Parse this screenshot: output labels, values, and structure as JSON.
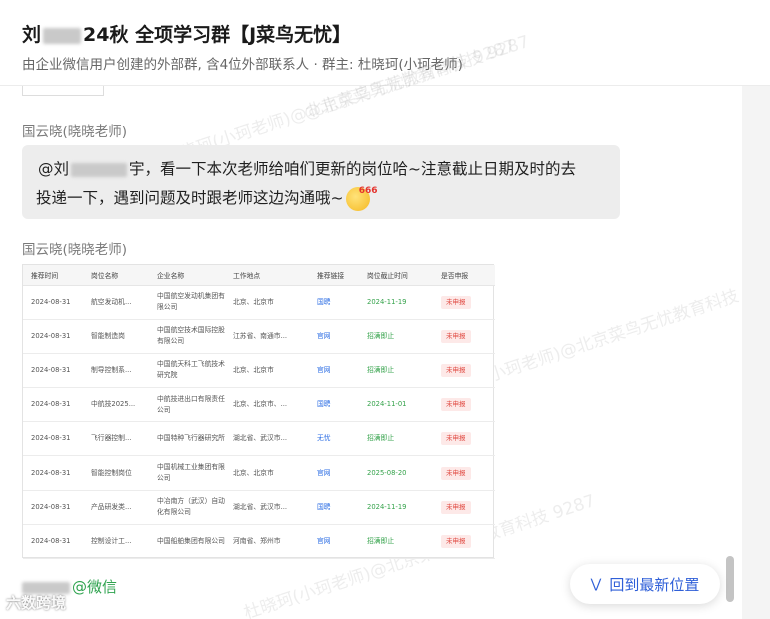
{
  "header": {
    "title_prefix": "刘",
    "title_suffix": "24秋 全项学习群【J菜鸟无忧】",
    "subtitle": "由企业微信用户创建的外部群, 含4位外部联系人 · 群主: 杜晓珂(小珂老师)"
  },
  "messages": {
    "sender1": "国云晓(晓晓老师)",
    "bubble_mention": "@刘",
    "bubble_text_1": "宇，看一下本次老师给咱们更新的岗位哈~注意截止日期及时的去",
    "bubble_text_2": "投递一下，遇到问题及时跟老师这边沟通哦~",
    "emoji_label": "666",
    "sender2": "国云晓(晓晓老师)",
    "wechat_suffix": "@微信"
  },
  "table": {
    "headers": [
      "推荐时间",
      "岗位名称",
      "企业名称",
      "工作地点",
      "推荐链接",
      "岗位截止时间",
      "是否申报"
    ],
    "rows": [
      [
        "2024-08-31",
        "航空发动机...",
        "中国航空发动机集团有限公司",
        "北京、北京市",
        "国聘",
        "2024-11-19",
        "未申报"
      ],
      [
        "2024-08-31",
        "智能制造岗",
        "中国航空技术国际控股有限公司",
        "江苏省、南通市...",
        "官网",
        "招满即止",
        "未申报"
      ],
      [
        "2024-08-31",
        "制导控制系...",
        "中国航天科工飞航技术研究院",
        "北京、北京市",
        "官网",
        "招满即止",
        "未申报"
      ],
      [
        "2024-08-31",
        "中航技2025...",
        "中航技进出口有限责任公司",
        "北京、北京市、...",
        "国聘",
        "2024-11-01",
        "未申报"
      ],
      [
        "2024-08-31",
        "飞行器控制...",
        "中国特种飞行器研究所",
        "湖北省、武汉市...",
        "无忧",
        "招满即止",
        "未申报"
      ],
      [
        "2024-08-31",
        "智能控制岗位",
        "中国机械工业集团有限公司",
        "北京、北京市",
        "官网",
        "2025-08-20",
        "未申报"
      ],
      [
        "2024-08-31",
        "产品研发类...",
        "中冶南方（武汉）自动化有限公司",
        "湖北省、武汉市...",
        "国聘",
        "2024-11-19",
        "未申报"
      ],
      [
        "2024-08-31",
        "控制设计工...",
        "中国船舶集团有限公司",
        "河南省、郑州市",
        "官网",
        "招满即止",
        "未申报"
      ]
    ]
  },
  "jump_button": {
    "label": "回到最新位置",
    "icon": "double-chevron-down-icon"
  },
  "watermarks": {
    "text_a": "杜晓珂(小珂老师)@北京菜鸟无忧教育科技 9287",
    "text_b": "@北京菜鸟无忧教育科技 9287"
  },
  "corner_logo": "六数跨境",
  "colors": {
    "link": "#2f6fe4",
    "deadline": "#36a34c",
    "status": "#e0473f",
    "wechat": "#2fa34f",
    "jump_button_text": "#2f5fd8"
  }
}
